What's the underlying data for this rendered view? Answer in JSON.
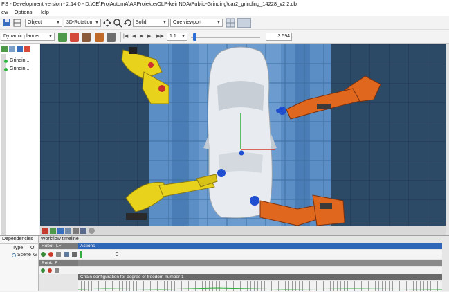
{
  "window": {
    "title": "PS - Development version - 2.14.0 - D:\\CE\\ProjAutomA\\AAProjekte\\OLP-keinNDA\\Public-Grinding\\car2_grinding_14228_v2.2.db"
  },
  "menu": {
    "items": [
      "ew",
      "Options",
      "Help"
    ]
  },
  "toolbar": {
    "object_select": "Object",
    "rotation_select": "3D-Rotation",
    "render_select": "Solid",
    "viewport_select": "One viewport",
    "planner_select": "Dynamic planner",
    "speed_select": "1:1",
    "time_value": "3.594"
  },
  "tree": {
    "items": [
      "Grindin...",
      "Grindin..."
    ]
  },
  "dependencies": {
    "header": "Dependencies",
    "type_label": "Type",
    "type_value_short": "O",
    "scene_label": "Scene",
    "scene_value_short": "G"
  },
  "timeline": {
    "header": "Workflow timeline",
    "track1_label": "Robot_LF",
    "track1_state": "Actions",
    "track2_label": "Robi-LF",
    "track3_label": "Chain configuration for degree of freedom number 1"
  },
  "colors": {
    "floor": "#2c4a66",
    "blue_zone": "#5a8ec4",
    "yellow_robot": "#e8d21c",
    "orange_robot": "#e0681e",
    "car_body": "#e8ebef",
    "accent_blue": "#1f4fd0",
    "status_green": "#2db83d"
  }
}
